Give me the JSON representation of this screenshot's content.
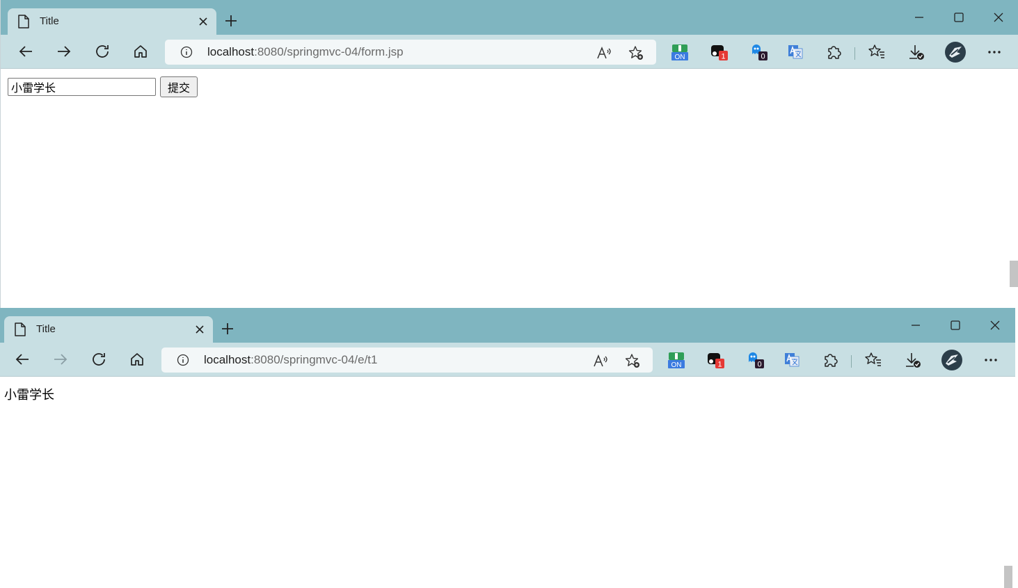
{
  "colors": {
    "tabstrip": "#7fb5c0",
    "toolbar": "#c8dfe3",
    "addressbar": "#f3f7f8"
  },
  "windows": [
    {
      "tab_title": "Title",
      "url_host": "localhost",
      "url_rest": ":8080/springmvc-04/form.jsp",
      "ext_on_label": "ON",
      "ext_badge_red": "1",
      "ext_badge_dark": "0",
      "form": {
        "input_value": "小雷学长",
        "submit_label": "提交"
      }
    },
    {
      "tab_title": "Title",
      "url_host": "localhost",
      "url_rest": ":8080/springmvc-04/e/t1",
      "ext_on_label": "ON",
      "ext_badge_red": "1",
      "ext_badge_dark": "0",
      "result_text": "小雷学长"
    }
  ]
}
